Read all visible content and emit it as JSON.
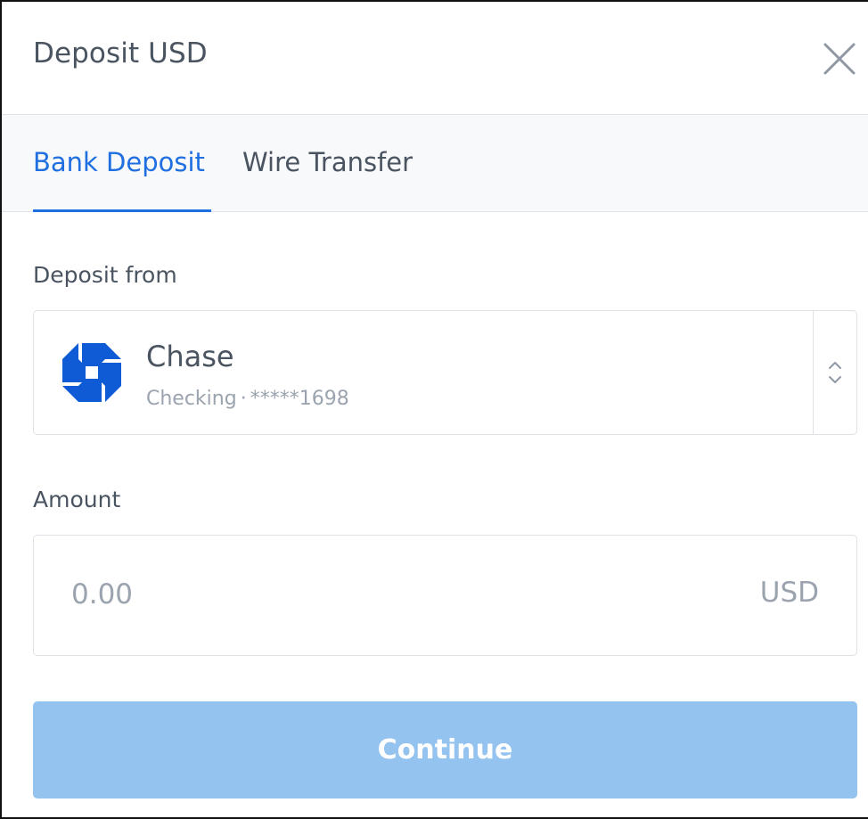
{
  "header": {
    "title": "Deposit USD"
  },
  "tabs": [
    {
      "label": "Bank Deposit",
      "active": true
    },
    {
      "label": "Wire Transfer",
      "active": false
    }
  ],
  "deposit_from": {
    "label": "Deposit from",
    "account": {
      "bank_name": "Chase",
      "account_type": "Checking",
      "separator": "·",
      "masked_number": "*****1698",
      "logo_color": "#0f5bd6"
    }
  },
  "amount": {
    "label": "Amount",
    "value": "",
    "placeholder": "0.00",
    "currency": "USD"
  },
  "continue_button": {
    "label": "Continue",
    "color": "#93c3ee"
  },
  "colors": {
    "accent": "#1f6fe0",
    "text": "#4a5461",
    "muted": "#9aa3ae",
    "border": "#dfe3e8",
    "tabbar_bg": "#f7f9fb"
  },
  "icons": {
    "close": "close-icon",
    "bank_logo": "chase-logo-icon",
    "stepper": "chevron-up-down-icon"
  }
}
